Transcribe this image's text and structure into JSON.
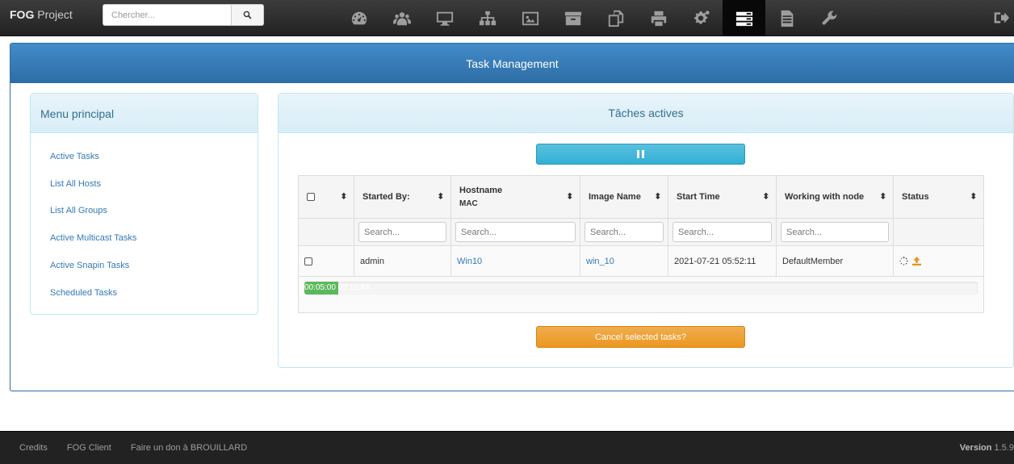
{
  "navbar": {
    "brand_bold": "FOG",
    "brand_rest": " Project",
    "search_placeholder": "Chercher...",
    "icons": [
      "dashboard-icon",
      "users-icon",
      "hosts-icon",
      "groups-icon",
      "images-icon",
      "storage-icon",
      "snapins-icon",
      "printers-icon",
      "services-icon",
      "tasks-icon",
      "reports-icon",
      "settings-icon"
    ],
    "active_icon": "tasks-icon"
  },
  "main": {
    "title": "Task Management"
  },
  "menu": {
    "title": "Menu principal",
    "items": [
      "Active Tasks",
      "List All Hosts",
      "List All Groups",
      "Active Multicast Tasks",
      "Active Snapin Tasks",
      "Scheduled Tasks"
    ]
  },
  "tasks": {
    "title": "Tâches actives",
    "columns": {
      "started_by": "Started By:",
      "hostname": "Hostname",
      "mac": "MAC",
      "image_name": "Image Name",
      "start_time": "Start Time",
      "working_node": "Working with node",
      "status": "Status"
    },
    "filter_placeholder": "Search...",
    "rows": [
      {
        "started_by": "admin",
        "hostname": "Win10",
        "image_name": "win_10",
        "start_time": "2021-07-21 05:52:11",
        "working_node": "DefaultMember",
        "progress_text": "00:05:00 00:15:44",
        "progress_fraction": 0.05
      }
    ],
    "cancel_label": "Cancel selected tasks?"
  },
  "footer": {
    "links": [
      "Credits",
      "FOG Client",
      "Faire un don à BROUILLARD"
    ],
    "version_label": "Version",
    "version_number": "1.5.9"
  },
  "colors": {
    "primary": "#2e6da4",
    "info": "#5bc0de",
    "warning": "#f0ad4e",
    "success": "#5cb85c",
    "navbar": "#222222"
  }
}
